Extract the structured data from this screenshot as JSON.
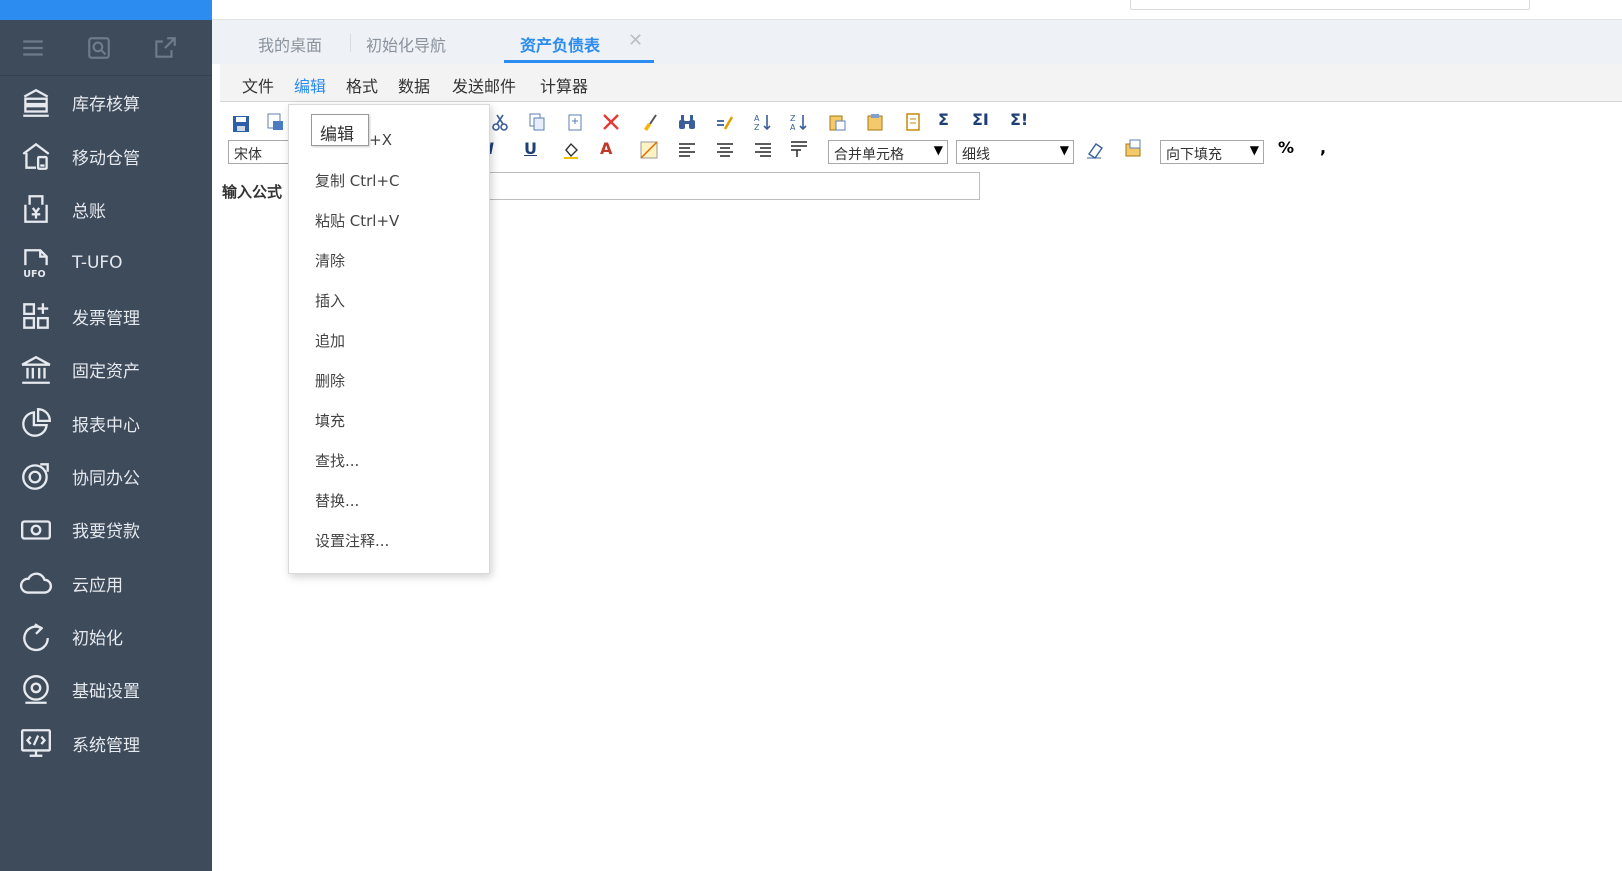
{
  "sidebar": {
    "tools": [
      {
        "icon": "menu-icon"
      },
      {
        "icon": "screen-search-icon"
      },
      {
        "icon": "external-window-icon"
      }
    ],
    "items": [
      {
        "label": "库存核算",
        "icon": "inventory-icon"
      },
      {
        "label": "移动仓管",
        "icon": "mobile-warehouse-icon"
      },
      {
        "label": "总账",
        "icon": "ledger-icon"
      },
      {
        "label": "T-UFO",
        "icon": "ufo-file-icon"
      },
      {
        "label": "发票管理",
        "icon": "invoice-grid-icon"
      },
      {
        "label": "固定资产",
        "icon": "bank-icon"
      },
      {
        "label": "报表中心",
        "icon": "pie-chart-icon"
      },
      {
        "label": "协同办公",
        "icon": "collaboration-icon"
      },
      {
        "label": "我要贷款",
        "icon": "cash-icon"
      },
      {
        "label": "云应用",
        "icon": "cloud-icon"
      },
      {
        "label": "初始化",
        "icon": "refresh-icon"
      },
      {
        "label": "基础设置",
        "icon": "settings-icon"
      },
      {
        "label": "系统管理",
        "icon": "code-monitor-icon"
      }
    ]
  },
  "tabs": [
    {
      "label": "我的桌面"
    },
    {
      "label": "初始化导航"
    },
    {
      "label": "资产负债表",
      "active": true
    }
  ],
  "menubar": {
    "items": [
      "文件",
      "编辑",
      "格式",
      "数据",
      "发送邮件",
      "计算器"
    ],
    "active": "编辑"
  },
  "toolbar": {
    "font_value": "宋体",
    "italic": "I",
    "underline": "U",
    "font_color": "A",
    "merge_value": "合并单元格",
    "border_value": "细线",
    "fill_value": "向下填充",
    "percent": "%",
    "comma": ",",
    "sigma1": "Σ",
    "sigma2": "ΣI",
    "sigma3": "Σ!",
    "formula_label": "输入公式"
  },
  "edit_dropdown": {
    "tooltip": "编辑",
    "items": [
      {
        "label": "剪切 Ctrl+X",
        "visible_fragment": "l+X"
      },
      {
        "label": "复制 Ctrl+C"
      },
      {
        "label": "粘贴 Ctrl+V"
      },
      {
        "label": "清除"
      },
      {
        "label": "插入"
      },
      {
        "label": "追加"
      },
      {
        "label": "删除"
      },
      {
        "label": "填充"
      },
      {
        "label": "查找..."
      },
      {
        "label": "替换..."
      },
      {
        "label": "设置注释..."
      }
    ]
  },
  "colors": {
    "sidebar_bg": "#3e4b5b",
    "accent": "#2d8cf0",
    "delete_red": "#e53935"
  }
}
